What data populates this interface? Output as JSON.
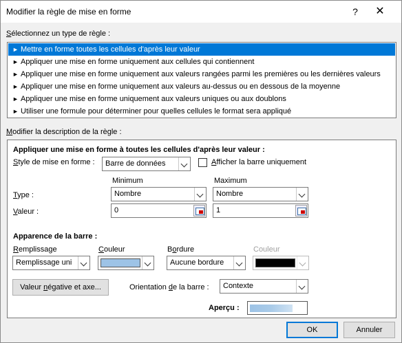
{
  "window": {
    "title": "Modifier la règle de mise en forme",
    "help": "?",
    "close": "✕"
  },
  "rule_type": {
    "label_pre": "",
    "label_u": "S",
    "label_post": "électionnez un type de règle :",
    "items": [
      "Mettre en forme toutes les cellules d'après leur valeur",
      "Appliquer une mise en forme uniquement aux cellules qui contiennent",
      "Appliquer une mise en forme uniquement aux valeurs rangées parmi les premières ou les dernières valeurs",
      "Appliquer une mise en forme uniquement aux valeurs au-dessus ou en dessous de la moyenne",
      "Appliquer une mise en forme uniquement aux valeurs uniques ou aux doublons",
      "Utiliser une formule pour déterminer pour quelles cellules le format sera appliqué"
    ],
    "selected_index": 0,
    "arrow": "►"
  },
  "description": {
    "label_pre": "",
    "label_u": "M",
    "label_post": "odifier la description de la règle :",
    "heading": "Appliquer une mise en forme à toutes les cellules d'après leur valeur :",
    "style_label_pre": "",
    "style_label_u": "S",
    "style_label_post": "tyle de mise en forme :",
    "style_value": "Barre de données",
    "show_bar_only_pre": "",
    "show_bar_only_u": "A",
    "show_bar_only_post": "fficher la barre uniquement",
    "show_bar_only_checked": false,
    "minimum": "Minimum",
    "maximum": "Maximum",
    "type_label_pre": "",
    "type_label_u": "T",
    "type_label_post": "ype :",
    "value_label_pre": "",
    "value_label_u": "V",
    "value_label_post": "aleur :",
    "min_type": "Nombre",
    "max_type": "Nombre",
    "min_value": "0",
    "max_value": "1"
  },
  "bar": {
    "heading": "Apparence de la barre :",
    "fill_label_pre": "",
    "fill_label_u": "R",
    "fill_label_post": "emplissage",
    "fill_value": "Remplissage uni",
    "color_label_pre": "",
    "color_label_u": "C",
    "color_label_post": "ouleur",
    "fill_color": "#9dc3e6",
    "border_label_pre": "B",
    "border_label_u": "o",
    "border_label_post": "rdure",
    "border_value": "Aucune bordure",
    "border_color_label": "Couleur",
    "border_color": "#000000",
    "negative_btn_pre": "Valeur ",
    "negative_btn_u": "n",
    "negative_btn_post": "égative et axe...",
    "orientation_label_pre": "Orientation ",
    "orientation_label_u": "d",
    "orientation_label_post": "e la barre :",
    "orientation_value": "Contexte",
    "preview_label": "Aperçu :"
  },
  "footer": {
    "ok": "OK",
    "cancel": "Annuler"
  }
}
